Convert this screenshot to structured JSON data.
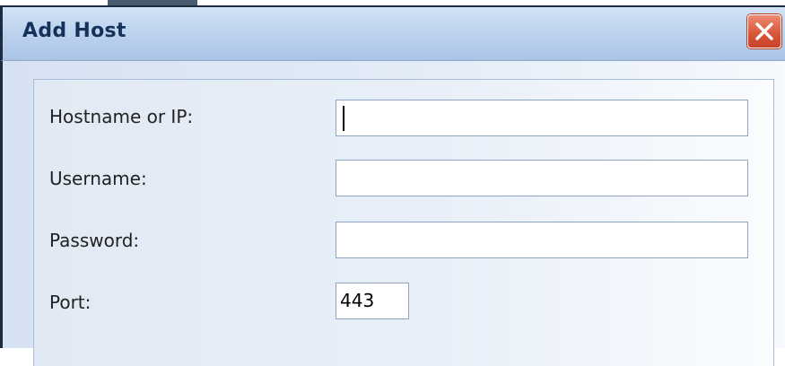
{
  "window": {
    "title": "Add Host",
    "close_icon": "close-icon"
  },
  "form": {
    "fields": [
      {
        "label": "Hostname or IP:",
        "value": "",
        "focused": true
      },
      {
        "label": "Username:",
        "value": ""
      },
      {
        "label": "Password:",
        "value": ""
      },
      {
        "label": "Port:",
        "value": "443"
      }
    ]
  },
  "colors": {
    "title_text": "#15325c",
    "close_button": "#d9573b",
    "panel_background": "#e1e9f4"
  }
}
